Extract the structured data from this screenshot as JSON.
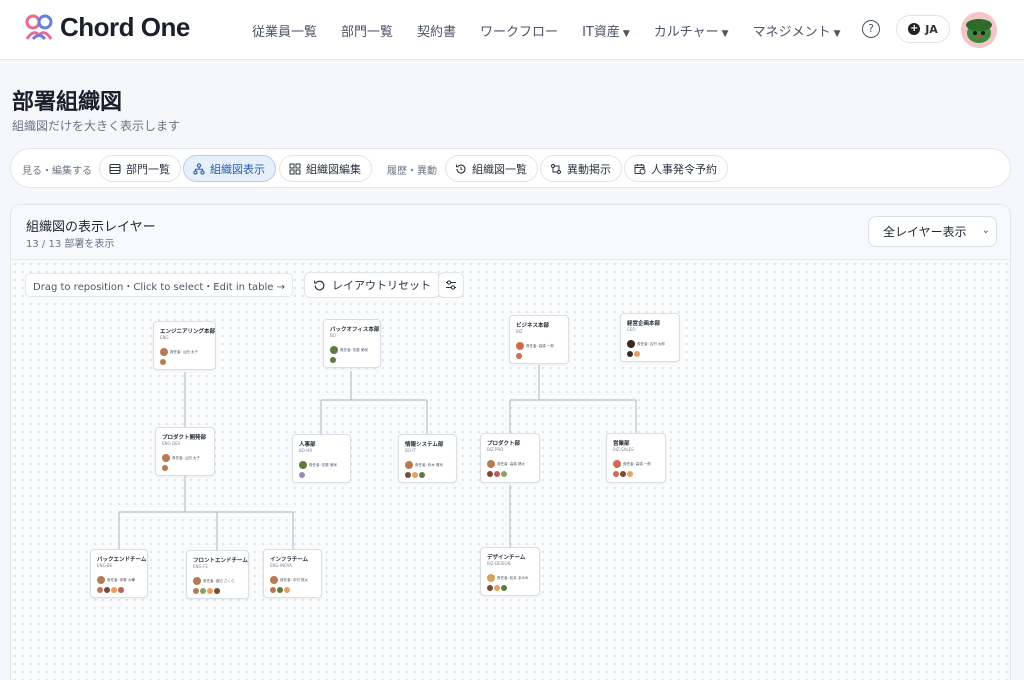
{
  "brand": {
    "name": "Chord One"
  },
  "nav": [
    {
      "label": "従業員一覧",
      "dropdown": false
    },
    {
      "label": "部門一覧",
      "dropdown": false
    },
    {
      "label": "契約書",
      "dropdown": false
    },
    {
      "label": "ワークフロー",
      "dropdown": false
    },
    {
      "label": "IT資産",
      "dropdown": true
    },
    {
      "label": "カルチャー",
      "dropdown": true
    },
    {
      "label": "マネジメント",
      "dropdown": true
    }
  ],
  "header": {
    "help_icon": "question-circle-icon",
    "lang_label": "JA"
  },
  "page": {
    "title": "部署組織図",
    "subtitle": "組織図だけを大きく表示します"
  },
  "toolbar": {
    "group1_label": "見る・編集する",
    "group2_label": "履歴・異動",
    "buttons": [
      {
        "label": "部門一覧",
        "icon": "list-icon",
        "active": false
      },
      {
        "label": "組織図表示",
        "icon": "org-tree-icon",
        "active": true
      },
      {
        "label": "組織図編集",
        "icon": "grid-icon",
        "active": false
      },
      {
        "label": "組織図一覧",
        "icon": "history-icon",
        "active": false
      },
      {
        "label": "異動掲示",
        "icon": "transfer-icon",
        "active": false
      },
      {
        "label": "人事発令予約",
        "icon": "calendar-clock-icon",
        "active": false
      }
    ]
  },
  "panel": {
    "title": "組織図の表示レイヤー",
    "count": "13 / 13 部署を表示",
    "layer_select": "全レイヤー表示",
    "hint": "Drag to reposition・Click to select・Edit in table →",
    "reset_label": "レイアウトリセット"
  },
  "accent": "#2a5fa8",
  "org_nodes": [
    {
      "id": "eng",
      "name": "エンジニアリング本部",
      "code": "ENG",
      "manager": "責任者: 山田 太子",
      "members": 1
    },
    {
      "id": "prod",
      "name": "プロダクト開発部",
      "code": "ENG-DEV",
      "manager": "責任者: 山田 太子",
      "members": 1
    },
    {
      "id": "backend",
      "name": "バックエンドチーム",
      "code": "ENG-BE",
      "manager": "責任者: 伊藤 大輔",
      "members": 4
    },
    {
      "id": "frontend",
      "name": "フロントエンドチーム",
      "code": "ENG-FE",
      "manager": "責任者: 渡辺 さくら",
      "members": 4
    },
    {
      "id": "infra",
      "name": "インフラチーム",
      "code": "ENG-INFRA",
      "manager": "責任者: 中村 悠太",
      "members": 3
    },
    {
      "id": "backoffice",
      "name": "バックオフィス本部",
      "code": "BO",
      "manager": "責任者: 佐藤 美咲",
      "members": 1
    },
    {
      "id": "hr",
      "name": "人事部",
      "code": "BO-HR",
      "manager": "責任者: 佐藤 美咲",
      "members": 1
    },
    {
      "id": "infosys",
      "name": "情報システム部",
      "code": "BO-IT",
      "manager": "責任者: 鈴木 健司",
      "members": 3
    },
    {
      "id": "biz",
      "name": "ビジネス本部",
      "code": "BIZ",
      "manager": "責任者: 高橋 一郎",
      "members": 1
    },
    {
      "id": "bizprod",
      "name": "プロダクト部",
      "code": "BIZ-PRD",
      "manager": "責任者: 高橋 健太",
      "members": 3
    },
    {
      "id": "design",
      "name": "デザインチーム",
      "code": "BIZ-DESIGN",
      "manager": "責任者: 松本 あゆみ",
      "members": 3
    },
    {
      "id": "sales",
      "name": "営業部",
      "code": "BIZ-SALES",
      "manager": "責任者: 高橋 一郎",
      "members": 3
    },
    {
      "id": "ceo",
      "name": "経営企画本部",
      "code": "CEO",
      "manager": "責任者: 吉村 太郎",
      "members": 2
    }
  ]
}
